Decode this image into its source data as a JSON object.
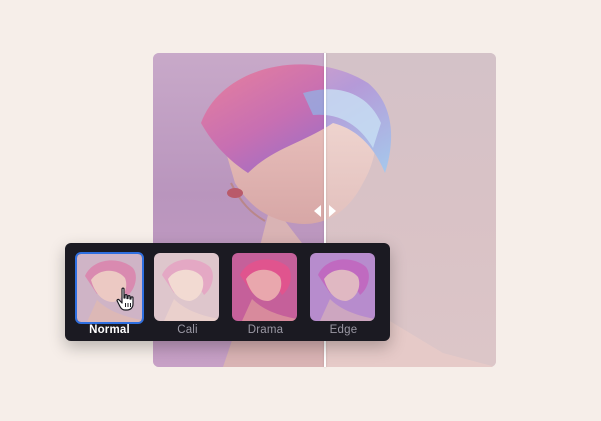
{
  "filters": [
    {
      "label": "Normal",
      "selected": true
    },
    {
      "label": "Cali",
      "selected": false
    },
    {
      "label": "Drama",
      "selected": false
    },
    {
      "label": "Edge",
      "selected": false
    }
  ],
  "colors": {
    "background": "#f6eee9",
    "panel": "#1b1a22",
    "selection": "#2f6fe0",
    "divider": "#ffffff"
  },
  "icons": {
    "split_handle": "left-right-arrows-icon",
    "cursor": "hand-pointer-icon"
  }
}
